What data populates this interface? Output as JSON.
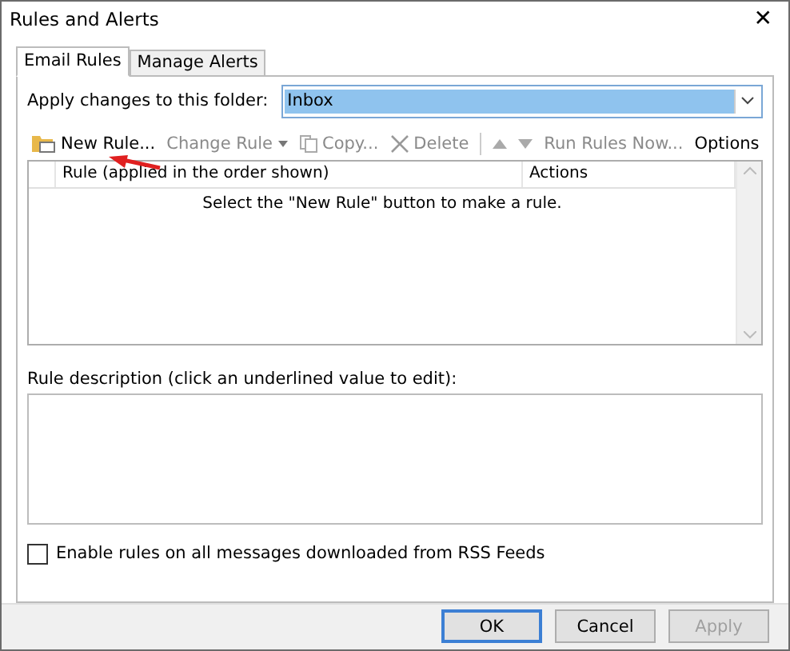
{
  "window": {
    "title": "Rules and Alerts",
    "close": "✕"
  },
  "tabs": [
    {
      "label": "Email Rules",
      "selected": true
    },
    {
      "label": "Manage Alerts",
      "selected": false
    }
  ],
  "folder": {
    "label": "Apply changes to this folder:",
    "value": "Inbox"
  },
  "toolbar": [
    {
      "kind": "new",
      "label": "New Rule...",
      "disabled": false
    },
    {
      "kind": "change",
      "label": "Change Rule",
      "disabled": true
    },
    {
      "kind": "copy",
      "label": "Copy...",
      "disabled": true
    },
    {
      "kind": "delete",
      "label": "Delete",
      "disabled": true
    },
    {
      "kind": "up",
      "disabled": true
    },
    {
      "kind": "down",
      "disabled": true
    },
    {
      "kind": "run",
      "label": "Run Rules Now...",
      "disabled": true
    },
    {
      "kind": "text",
      "label": "Options",
      "disabled": false
    }
  ],
  "table": {
    "columns": [
      "Rule (applied in the order shown)",
      "Actions"
    ],
    "empty_message": "Select the \"New Rule\" button to make a rule."
  },
  "description": {
    "label": "Rule description (click an underlined value to edit):"
  },
  "rss": {
    "label": "Enable rules on all messages downloaded from RSS Feeds",
    "checked": false
  },
  "buttons": [
    {
      "label": "OK",
      "disabled": false,
      "default": true
    },
    {
      "label": "Cancel",
      "disabled": false,
      "default": false
    },
    {
      "label": "Apply",
      "disabled": true,
      "default": false
    }
  ]
}
